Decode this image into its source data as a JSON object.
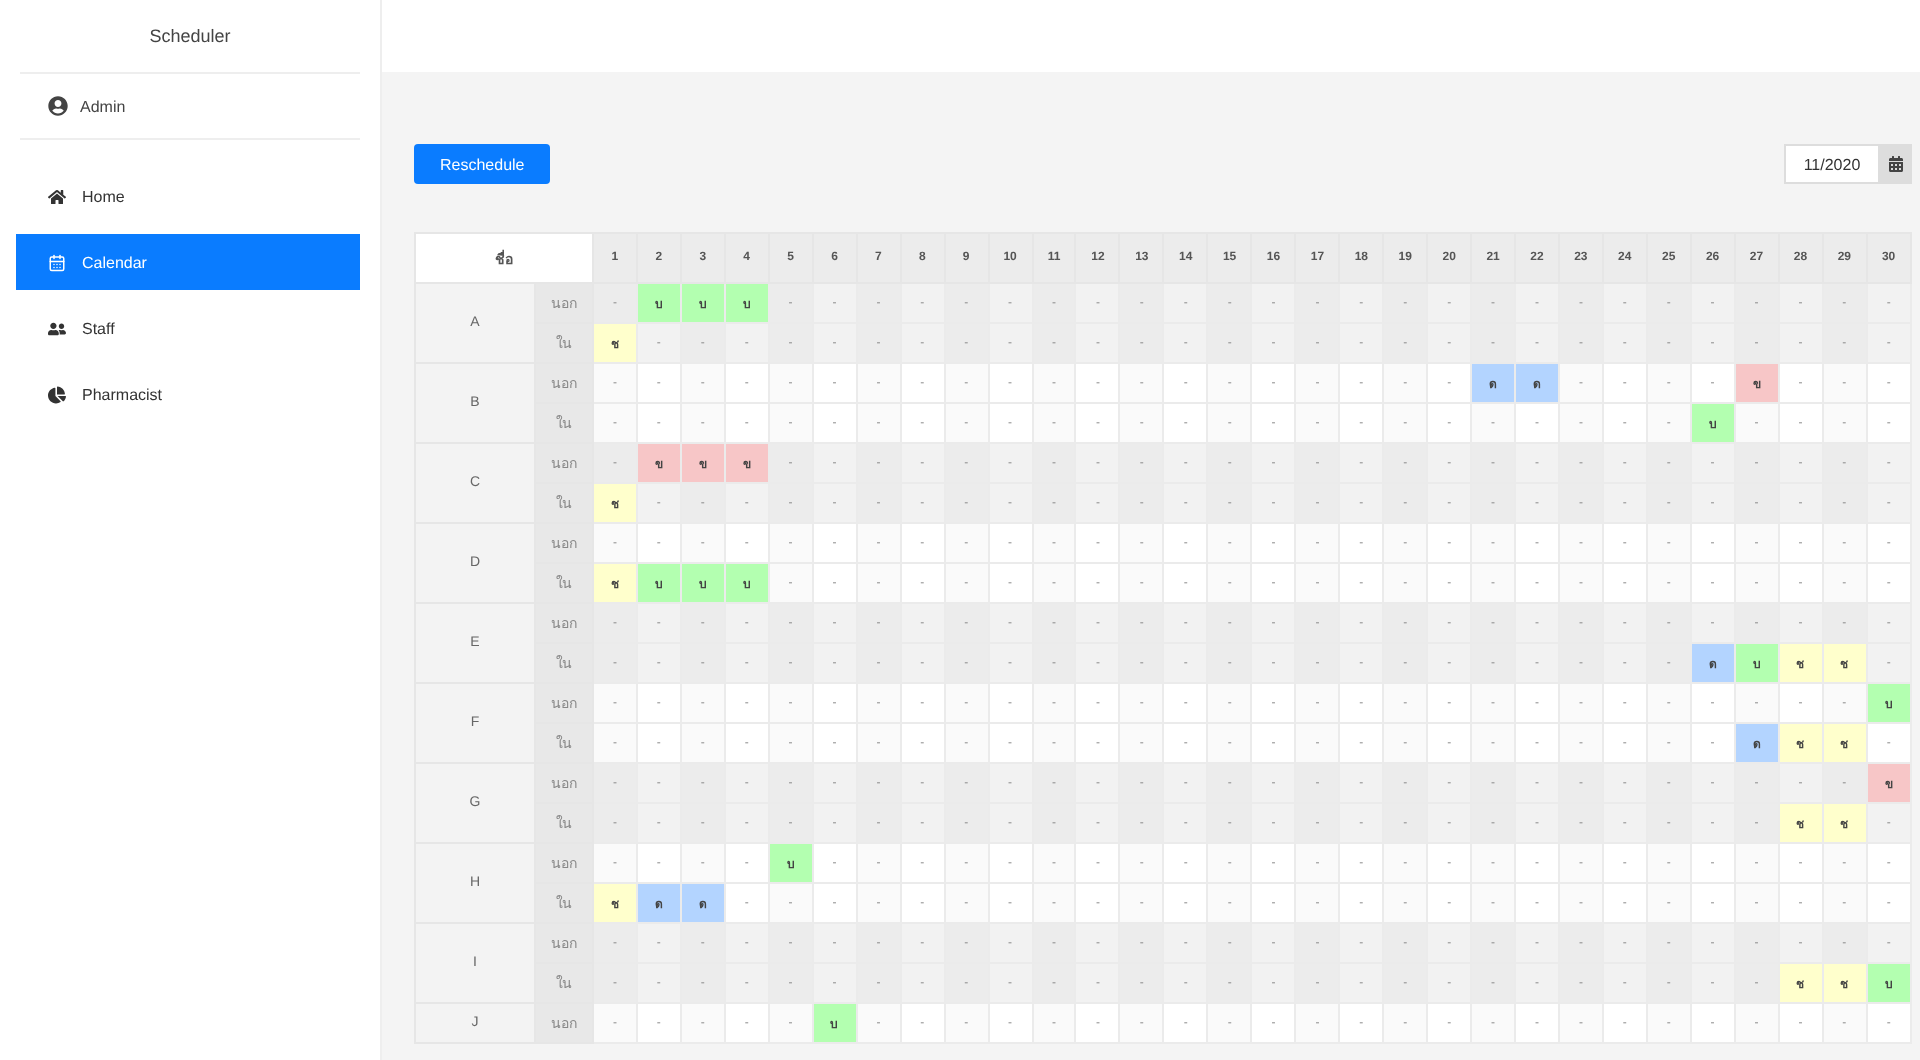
{
  "sidebar": {
    "title": "Scheduler",
    "user": "Admin",
    "items": [
      {
        "label": "Home",
        "kind": "home",
        "selected": false
      },
      {
        "label": "Calendar",
        "kind": "calendar",
        "selected": true
      },
      {
        "label": "Staff",
        "kind": "staff",
        "selected": false
      },
      {
        "label": "Pharmacist",
        "kind": "chart",
        "selected": false
      }
    ]
  },
  "toolbar": {
    "button": "Reschedule",
    "month": "11/2020"
  },
  "table": {
    "name_header": "ชื่อ",
    "days": [
      "1",
      "2",
      "3",
      "4",
      "5",
      "6",
      "7",
      "8",
      "9",
      "10",
      "11",
      "12",
      "13",
      "14",
      "15",
      "16",
      "17",
      "18",
      "19",
      "20",
      "21",
      "22",
      "23",
      "24",
      "25",
      "26",
      "27",
      "28",
      "29",
      "30"
    ],
    "groups": [
      {
        "name": "A",
        "rows": [
          {
            "label": "นอก",
            "cells": [
              {
                "text": "-"
              },
              {
                "text": "บ",
                "color": "#b3ffb0"
              },
              {
                "text": "บ",
                "color": "#b3ffb0"
              },
              {
                "text": "บ",
                "color": "#b3ffb0"
              },
              {
                "text": "-"
              },
              {
                "text": "-"
              },
              {
                "text": "-"
              },
              {
                "text": "-"
              },
              {
                "text": "-"
              },
              {
                "text": "-"
              },
              {
                "text": "-"
              },
              {
                "text": "-"
              },
              {
                "text": "-"
              },
              {
                "text": "-"
              },
              {
                "text": "-"
              },
              {
                "text": "-"
              },
              {
                "text": "-"
              },
              {
                "text": "-"
              },
              {
                "text": "-"
              },
              {
                "text": "-"
              },
              {
                "text": "-"
              },
              {
                "text": "-"
              },
              {
                "text": "-"
              },
              {
                "text": "-"
              },
              {
                "text": "-"
              },
              {
                "text": "-"
              },
              {
                "text": "-"
              },
              {
                "text": "-"
              },
              {
                "text": "-"
              },
              {
                "text": "-"
              }
            ]
          },
          {
            "label": "ใน",
            "cells": [
              {
                "text": "ช",
                "color": "#ffffcc"
              },
              {
                "text": "-"
              },
              {
                "text": "-"
              },
              {
                "text": "-"
              },
              {
                "text": "-"
              },
              {
                "text": "-"
              },
              {
                "text": "-"
              },
              {
                "text": "-"
              },
              {
                "text": "-"
              },
              {
                "text": "-"
              },
              {
                "text": "-"
              },
              {
                "text": "-"
              },
              {
                "text": "-"
              },
              {
                "text": "-"
              },
              {
                "text": "-"
              },
              {
                "text": "-"
              },
              {
                "text": "-"
              },
              {
                "text": "-"
              },
              {
                "text": "-"
              },
              {
                "text": "-"
              },
              {
                "text": "-"
              },
              {
                "text": "-"
              },
              {
                "text": "-"
              },
              {
                "text": "-"
              },
              {
                "text": "-"
              },
              {
                "text": "-"
              },
              {
                "text": "-"
              },
              {
                "text": "-"
              },
              {
                "text": "-"
              },
              {
                "text": "-"
              }
            ]
          }
        ]
      },
      {
        "name": "B",
        "rows": [
          {
            "label": "นอก",
            "cells": [
              {
                "text": "-"
              },
              {
                "text": "-"
              },
              {
                "text": "-"
              },
              {
                "text": "-"
              },
              {
                "text": "-"
              },
              {
                "text": "-"
              },
              {
                "text": "-"
              },
              {
                "text": "-"
              },
              {
                "text": "-"
              },
              {
                "text": "-"
              },
              {
                "text": "-"
              },
              {
                "text": "-"
              },
              {
                "text": "-"
              },
              {
                "text": "-"
              },
              {
                "text": "-"
              },
              {
                "text": "-"
              },
              {
                "text": "-"
              },
              {
                "text": "-"
              },
              {
                "text": "-"
              },
              {
                "text": "-"
              },
              {
                "text": "ด",
                "color": "#b3d4ff"
              },
              {
                "text": "ด",
                "color": "#b3d4ff"
              },
              {
                "text": "-"
              },
              {
                "text": "-"
              },
              {
                "text": "-"
              },
              {
                "text": "-"
              },
              {
                "text": "ข",
                "color": "#f7c6c7"
              },
              {
                "text": "-"
              },
              {
                "text": "-"
              },
              {
                "text": "-"
              }
            ]
          },
          {
            "label": "ใน",
            "cells": [
              {
                "text": "-"
              },
              {
                "text": "-"
              },
              {
                "text": "-"
              },
              {
                "text": "-"
              },
              {
                "text": "-"
              },
              {
                "text": "-"
              },
              {
                "text": "-"
              },
              {
                "text": "-"
              },
              {
                "text": "-"
              },
              {
                "text": "-"
              },
              {
                "text": "-"
              },
              {
                "text": "-"
              },
              {
                "text": "-"
              },
              {
                "text": "-"
              },
              {
                "text": "-"
              },
              {
                "text": "-"
              },
              {
                "text": "-"
              },
              {
                "text": "-"
              },
              {
                "text": "-"
              },
              {
                "text": "-"
              },
              {
                "text": "-"
              },
              {
                "text": "-"
              },
              {
                "text": "-"
              },
              {
                "text": "-"
              },
              {
                "text": "-"
              },
              {
                "text": "บ",
                "color": "#b3ffb0"
              },
              {
                "text": "-"
              },
              {
                "text": "-"
              },
              {
                "text": "-"
              },
              {
                "text": "-"
              }
            ]
          }
        ]
      },
      {
        "name": "C",
        "rows": [
          {
            "label": "นอก",
            "cells": [
              {
                "text": "-"
              },
              {
                "text": "ข",
                "color": "#f7c6c7"
              },
              {
                "text": "ข",
                "color": "#f7c6c7"
              },
              {
                "text": "ข",
                "color": "#f7c6c7"
              },
              {
                "text": "-"
              },
              {
                "text": "-"
              },
              {
                "text": "-"
              },
              {
                "text": "-"
              },
              {
                "text": "-"
              },
              {
                "text": "-"
              },
              {
                "text": "-"
              },
              {
                "text": "-"
              },
              {
                "text": "-"
              },
              {
                "text": "-"
              },
              {
                "text": "-"
              },
              {
                "text": "-"
              },
              {
                "text": "-"
              },
              {
                "text": "-"
              },
              {
                "text": "-"
              },
              {
                "text": "-"
              },
              {
                "text": "-"
              },
              {
                "text": "-"
              },
              {
                "text": "-"
              },
              {
                "text": "-"
              },
              {
                "text": "-"
              },
              {
                "text": "-"
              },
              {
                "text": "-"
              },
              {
                "text": "-"
              },
              {
                "text": "-"
              },
              {
                "text": "-"
              }
            ]
          },
          {
            "label": "ใน",
            "cells": [
              {
                "text": "ช",
                "color": "#ffffcc"
              },
              {
                "text": "-"
              },
              {
                "text": "-"
              },
              {
                "text": "-"
              },
              {
                "text": "-"
              },
              {
                "text": "-"
              },
              {
                "text": "-"
              },
              {
                "text": "-"
              },
              {
                "text": "-"
              },
              {
                "text": "-"
              },
              {
                "text": "-"
              },
              {
                "text": "-"
              },
              {
                "text": "-"
              },
              {
                "text": "-"
              },
              {
                "text": "-"
              },
              {
                "text": "-"
              },
              {
                "text": "-"
              },
              {
                "text": "-"
              },
              {
                "text": "-"
              },
              {
                "text": "-"
              },
              {
                "text": "-"
              },
              {
                "text": "-"
              },
              {
                "text": "-"
              },
              {
                "text": "-"
              },
              {
                "text": "-"
              },
              {
                "text": "-"
              },
              {
                "text": "-"
              },
              {
                "text": "-"
              },
              {
                "text": "-"
              },
              {
                "text": "-"
              }
            ]
          }
        ]
      },
      {
        "name": "D",
        "rows": [
          {
            "label": "นอก",
            "cells": [
              {
                "text": "-"
              },
              {
                "text": "-"
              },
              {
                "text": "-"
              },
              {
                "text": "-"
              },
              {
                "text": "-"
              },
              {
                "text": "-"
              },
              {
                "text": "-"
              },
              {
                "text": "-"
              },
              {
                "text": "-"
              },
              {
                "text": "-"
              },
              {
                "text": "-"
              },
              {
                "text": "-"
              },
              {
                "text": "-"
              },
              {
                "text": "-"
              },
              {
                "text": "-"
              },
              {
                "text": "-"
              },
              {
                "text": "-"
              },
              {
                "text": "-"
              },
              {
                "text": "-"
              },
              {
                "text": "-"
              },
              {
                "text": "-"
              },
              {
                "text": "-"
              },
              {
                "text": "-"
              },
              {
                "text": "-"
              },
              {
                "text": "-"
              },
              {
                "text": "-"
              },
              {
                "text": "-"
              },
              {
                "text": "-"
              },
              {
                "text": "-"
              },
              {
                "text": "-"
              }
            ]
          },
          {
            "label": "ใน",
            "cells": [
              {
                "text": "ช",
                "color": "#ffffcc"
              },
              {
                "text": "บ",
                "color": "#b3ffb0"
              },
              {
                "text": "บ",
                "color": "#b3ffb0"
              },
              {
                "text": "บ",
                "color": "#b3ffb0"
              },
              {
                "text": "-"
              },
              {
                "text": "-"
              },
              {
                "text": "-"
              },
              {
                "text": "-"
              },
              {
                "text": "-"
              },
              {
                "text": "-"
              },
              {
                "text": "-"
              },
              {
                "text": "-"
              },
              {
                "text": "-"
              },
              {
                "text": "-"
              },
              {
                "text": "-"
              },
              {
                "text": "-"
              },
              {
                "text": "-"
              },
              {
                "text": "-"
              },
              {
                "text": "-"
              },
              {
                "text": "-"
              },
              {
                "text": "-"
              },
              {
                "text": "-"
              },
              {
                "text": "-"
              },
              {
                "text": "-"
              },
              {
                "text": "-"
              },
              {
                "text": "-"
              },
              {
                "text": "-"
              },
              {
                "text": "-"
              },
              {
                "text": "-"
              },
              {
                "text": "-"
              }
            ]
          }
        ]
      },
      {
        "name": "E",
        "rows": [
          {
            "label": "นอก",
            "cells": [
              {
                "text": "-"
              },
              {
                "text": "-"
              },
              {
                "text": "-"
              },
              {
                "text": "-"
              },
              {
                "text": "-"
              },
              {
                "text": "-"
              },
              {
                "text": "-"
              },
              {
                "text": "-"
              },
              {
                "text": "-"
              },
              {
                "text": "-"
              },
              {
                "text": "-"
              },
              {
                "text": "-"
              },
              {
                "text": "-"
              },
              {
                "text": "-"
              },
              {
                "text": "-"
              },
              {
                "text": "-"
              },
              {
                "text": "-"
              },
              {
                "text": "-"
              },
              {
                "text": "-"
              },
              {
                "text": "-"
              },
              {
                "text": "-"
              },
              {
                "text": "-"
              },
              {
                "text": "-"
              },
              {
                "text": "-"
              },
              {
                "text": "-"
              },
              {
                "text": "-"
              },
              {
                "text": "-"
              },
              {
                "text": "-"
              },
              {
                "text": "-"
              },
              {
                "text": "-"
              }
            ]
          },
          {
            "label": "ใน",
            "cells": [
              {
                "text": "-"
              },
              {
                "text": "-"
              },
              {
                "text": "-"
              },
              {
                "text": "-"
              },
              {
                "text": "-"
              },
              {
                "text": "-"
              },
              {
                "text": "-"
              },
              {
                "text": "-"
              },
              {
                "text": "-"
              },
              {
                "text": "-"
              },
              {
                "text": "-"
              },
              {
                "text": "-"
              },
              {
                "text": "-"
              },
              {
                "text": "-"
              },
              {
                "text": "-"
              },
              {
                "text": "-"
              },
              {
                "text": "-"
              },
              {
                "text": "-"
              },
              {
                "text": "-"
              },
              {
                "text": "-"
              },
              {
                "text": "-"
              },
              {
                "text": "-"
              },
              {
                "text": "-"
              },
              {
                "text": "-"
              },
              {
                "text": "-"
              },
              {
                "text": "ด",
                "color": "#b3d4ff"
              },
              {
                "text": "บ",
                "color": "#b3ffb0"
              },
              {
                "text": "ช",
                "color": "#ffffcc"
              },
              {
                "text": "ช",
                "color": "#ffffcc"
              },
              {
                "text": "-"
              }
            ]
          }
        ]
      },
      {
        "name": "F",
        "rows": [
          {
            "label": "นอก",
            "cells": [
              {
                "text": "-"
              },
              {
                "text": "-"
              },
              {
                "text": "-"
              },
              {
                "text": "-"
              },
              {
                "text": "-"
              },
              {
                "text": "-"
              },
              {
                "text": "-"
              },
              {
                "text": "-"
              },
              {
                "text": "-"
              },
              {
                "text": "-"
              },
              {
                "text": "-"
              },
              {
                "text": "-"
              },
              {
                "text": "-"
              },
              {
                "text": "-"
              },
              {
                "text": "-"
              },
              {
                "text": "-"
              },
              {
                "text": "-"
              },
              {
                "text": "-"
              },
              {
                "text": "-"
              },
              {
                "text": "-"
              },
              {
                "text": "-"
              },
              {
                "text": "-"
              },
              {
                "text": "-"
              },
              {
                "text": "-"
              },
              {
                "text": "-"
              },
              {
                "text": "-"
              },
              {
                "text": "-"
              },
              {
                "text": "-"
              },
              {
                "text": "-"
              },
              {
                "text": "บ",
                "color": "#b3ffb0"
              }
            ]
          },
          {
            "label": "ใน",
            "cells": [
              {
                "text": "-"
              },
              {
                "text": "-"
              },
              {
                "text": "-"
              },
              {
                "text": "-"
              },
              {
                "text": "-"
              },
              {
                "text": "-"
              },
              {
                "text": "-"
              },
              {
                "text": "-"
              },
              {
                "text": "-"
              },
              {
                "text": "-"
              },
              {
                "text": "-"
              },
              {
                "text": "-"
              },
              {
                "text": "-"
              },
              {
                "text": "-"
              },
              {
                "text": "-"
              },
              {
                "text": "-"
              },
              {
                "text": "-"
              },
              {
                "text": "-"
              },
              {
                "text": "-"
              },
              {
                "text": "-"
              },
              {
                "text": "-"
              },
              {
                "text": "-"
              },
              {
                "text": "-"
              },
              {
                "text": "-"
              },
              {
                "text": "-"
              },
              {
                "text": "-"
              },
              {
                "text": "ด",
                "color": "#b3d4ff"
              },
              {
                "text": "ช",
                "color": "#ffffcc"
              },
              {
                "text": "ช",
                "color": "#ffffcc"
              },
              {
                "text": "-"
              }
            ]
          }
        ]
      },
      {
        "name": "G",
        "rows": [
          {
            "label": "นอก",
            "cells": [
              {
                "text": "-"
              },
              {
                "text": "-"
              },
              {
                "text": "-"
              },
              {
                "text": "-"
              },
              {
                "text": "-"
              },
              {
                "text": "-"
              },
              {
                "text": "-"
              },
              {
                "text": "-"
              },
              {
                "text": "-"
              },
              {
                "text": "-"
              },
              {
                "text": "-"
              },
              {
                "text": "-"
              },
              {
                "text": "-"
              },
              {
                "text": "-"
              },
              {
                "text": "-"
              },
              {
                "text": "-"
              },
              {
                "text": "-"
              },
              {
                "text": "-"
              },
              {
                "text": "-"
              },
              {
                "text": "-"
              },
              {
                "text": "-"
              },
              {
                "text": "-"
              },
              {
                "text": "-"
              },
              {
                "text": "-"
              },
              {
                "text": "-"
              },
              {
                "text": "-"
              },
              {
                "text": "-"
              },
              {
                "text": "-"
              },
              {
                "text": "-"
              },
              {
                "text": "ข",
                "color": "#f7c6c7"
              }
            ]
          },
          {
            "label": "ใน",
            "cells": [
              {
                "text": "-"
              },
              {
                "text": "-"
              },
              {
                "text": "-"
              },
              {
                "text": "-"
              },
              {
                "text": "-"
              },
              {
                "text": "-"
              },
              {
                "text": "-"
              },
              {
                "text": "-"
              },
              {
                "text": "-"
              },
              {
                "text": "-"
              },
              {
                "text": "-"
              },
              {
                "text": "-"
              },
              {
                "text": "-"
              },
              {
                "text": "-"
              },
              {
                "text": "-"
              },
              {
                "text": "-"
              },
              {
                "text": "-"
              },
              {
                "text": "-"
              },
              {
                "text": "-"
              },
              {
                "text": "-"
              },
              {
                "text": "-"
              },
              {
                "text": "-"
              },
              {
                "text": "-"
              },
              {
                "text": "-"
              },
              {
                "text": "-"
              },
              {
                "text": "-"
              },
              {
                "text": "-"
              },
              {
                "text": "ช",
                "color": "#ffffcc"
              },
              {
                "text": "ช",
                "color": "#ffffcc"
              },
              {
                "text": "-"
              }
            ]
          }
        ]
      },
      {
        "name": "H",
        "rows": [
          {
            "label": "นอก",
            "cells": [
              {
                "text": "-"
              },
              {
                "text": "-"
              },
              {
                "text": "-"
              },
              {
                "text": "-"
              },
              {
                "text": "บ",
                "color": "#b3ffb0"
              },
              {
                "text": "-"
              },
              {
                "text": "-"
              },
              {
                "text": "-"
              },
              {
                "text": "-"
              },
              {
                "text": "-"
              },
              {
                "text": "-"
              },
              {
                "text": "-"
              },
              {
                "text": "-"
              },
              {
                "text": "-"
              },
              {
                "text": "-"
              },
              {
                "text": "-"
              },
              {
                "text": "-"
              },
              {
                "text": "-"
              },
              {
                "text": "-"
              },
              {
                "text": "-"
              },
              {
                "text": "-"
              },
              {
                "text": "-"
              },
              {
                "text": "-"
              },
              {
                "text": "-"
              },
              {
                "text": "-"
              },
              {
                "text": "-"
              },
              {
                "text": "-"
              },
              {
                "text": "-"
              },
              {
                "text": "-"
              },
              {
                "text": "-"
              }
            ]
          },
          {
            "label": "ใน",
            "cells": [
              {
                "text": "ช",
                "color": "#ffffcc"
              },
              {
                "text": "ด",
                "color": "#b3d4ff"
              },
              {
                "text": "ด",
                "color": "#b3d4ff"
              },
              {
                "text": "-"
              },
              {
                "text": "-"
              },
              {
                "text": "-"
              },
              {
                "text": "-"
              },
              {
                "text": "-"
              },
              {
                "text": "-"
              },
              {
                "text": "-"
              },
              {
                "text": "-"
              },
              {
                "text": "-"
              },
              {
                "text": "-"
              },
              {
                "text": "-"
              },
              {
                "text": "-"
              },
              {
                "text": "-"
              },
              {
                "text": "-"
              },
              {
                "text": "-"
              },
              {
                "text": "-"
              },
              {
                "text": "-"
              },
              {
                "text": "-"
              },
              {
                "text": "-"
              },
              {
                "text": "-"
              },
              {
                "text": "-"
              },
              {
                "text": "-"
              },
              {
                "text": "-"
              },
              {
                "text": "-"
              },
              {
                "text": "-"
              },
              {
                "text": "-"
              },
              {
                "text": "-"
              }
            ]
          }
        ]
      },
      {
        "name": "I",
        "rows": [
          {
            "label": "นอก",
            "cells": [
              {
                "text": "-"
              },
              {
                "text": "-"
              },
              {
                "text": "-"
              },
              {
                "text": "-"
              },
              {
                "text": "-"
              },
              {
                "text": "-"
              },
              {
                "text": "-"
              },
              {
                "text": "-"
              },
              {
                "text": "-"
              },
              {
                "text": "-"
              },
              {
                "text": "-"
              },
              {
                "text": "-"
              },
              {
                "text": "-"
              },
              {
                "text": "-"
              },
              {
                "text": "-"
              },
              {
                "text": "-"
              },
              {
                "text": "-"
              },
              {
                "text": "-"
              },
              {
                "text": "-"
              },
              {
                "text": "-"
              },
              {
                "text": "-"
              },
              {
                "text": "-"
              },
              {
                "text": "-"
              },
              {
                "text": "-"
              },
              {
                "text": "-"
              },
              {
                "text": "-"
              },
              {
                "text": "-"
              },
              {
                "text": "-"
              },
              {
                "text": "-"
              },
              {
                "text": "-"
              }
            ]
          },
          {
            "label": "ใน",
            "cells": [
              {
                "text": "-"
              },
              {
                "text": "-"
              },
              {
                "text": "-"
              },
              {
                "text": "-"
              },
              {
                "text": "-"
              },
              {
                "text": "-"
              },
              {
                "text": "-"
              },
              {
                "text": "-"
              },
              {
                "text": "-"
              },
              {
                "text": "-"
              },
              {
                "text": "-"
              },
              {
                "text": "-"
              },
              {
                "text": "-"
              },
              {
                "text": "-"
              },
              {
                "text": "-"
              },
              {
                "text": "-"
              },
              {
                "text": "-"
              },
              {
                "text": "-"
              },
              {
                "text": "-"
              },
              {
                "text": "-"
              },
              {
                "text": "-"
              },
              {
                "text": "-"
              },
              {
                "text": "-"
              },
              {
                "text": "-"
              },
              {
                "text": "-"
              },
              {
                "text": "-"
              },
              {
                "text": "-"
              },
              {
                "text": "ช",
                "color": "#ffffcc"
              },
              {
                "text": "ช",
                "color": "#ffffcc"
              },
              {
                "text": "บ",
                "color": "#b3ffb0"
              }
            ]
          }
        ]
      },
      {
        "name": "J",
        "rows": [
          {
            "label": "นอก",
            "cells": [
              {
                "text": "-"
              },
              {
                "text": "-"
              },
              {
                "text": "-"
              },
              {
                "text": "-"
              },
              {
                "text": "-"
              },
              {
                "text": "บ",
                "color": "#b3ffb0"
              },
              {
                "text": "-"
              },
              {
                "text": "-"
              },
              {
                "text": "-"
              },
              {
                "text": "-"
              },
              {
                "text": "-"
              },
              {
                "text": "-"
              },
              {
                "text": "-"
              },
              {
                "text": "-"
              },
              {
                "text": "-"
              },
              {
                "text": "-"
              },
              {
                "text": "-"
              },
              {
                "text": "-"
              },
              {
                "text": "-"
              },
              {
                "text": "-"
              },
              {
                "text": "-"
              },
              {
                "text": "-"
              },
              {
                "text": "-"
              },
              {
                "text": "-"
              },
              {
                "text": "-"
              },
              {
                "text": "-"
              },
              {
                "text": "-"
              },
              {
                "text": "-"
              },
              {
                "text": "-"
              },
              {
                "text": "-"
              }
            ]
          }
        ]
      }
    ]
  }
}
